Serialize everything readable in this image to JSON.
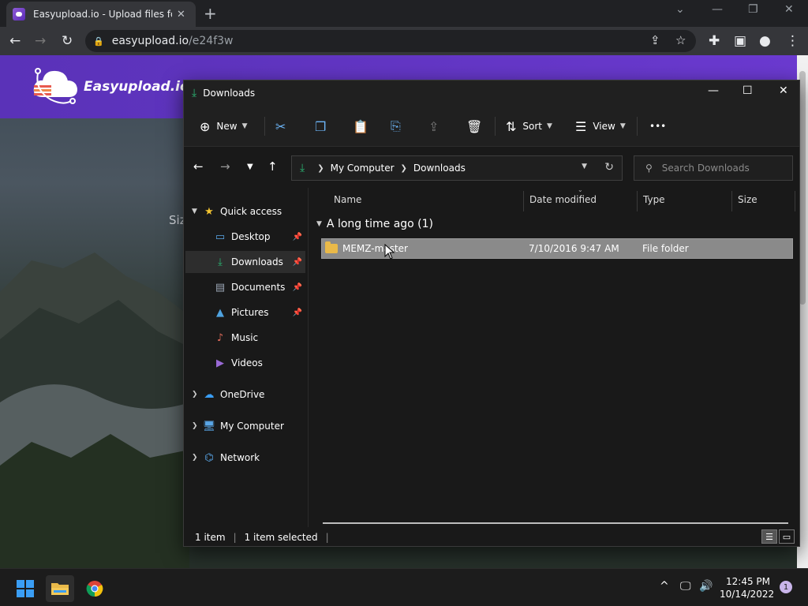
{
  "browser": {
    "tab_title": "Easyupload.io - Upload files for f",
    "tab_close": "✕",
    "new_tab": "+",
    "url_host": "easyupload.io",
    "url_path": "/e24f3w"
  },
  "website": {
    "logo_text": "Easyupload.io",
    "partial_text": "Siz"
  },
  "explorer": {
    "title": "Downloads",
    "commands": {
      "new": "New",
      "sort": "Sort",
      "view": "View",
      "more": "•••"
    },
    "address": {
      "crumbs": [
        "My Computer",
        "Downloads"
      ]
    },
    "search_placeholder": "Search Downloads",
    "nav_pane": [
      {
        "label": "Quick access",
        "icon": "star-icon"
      },
      {
        "label": "Desktop",
        "icon": "desktop-icon",
        "pinned": true
      },
      {
        "label": "Downloads",
        "icon": "download-icon",
        "pinned": true,
        "selected": true
      },
      {
        "label": "Documents",
        "icon": "document-icon",
        "pinned": true
      },
      {
        "label": "Pictures",
        "icon": "pictures-icon",
        "pinned": true
      },
      {
        "label": "Music",
        "icon": "music-icon"
      },
      {
        "label": "Videos",
        "icon": "videos-icon"
      },
      {
        "label": "OneDrive",
        "icon": "cloud-icon"
      },
      {
        "label": "My Computer",
        "icon": "computer-icon"
      },
      {
        "label": "Network",
        "icon": "network-icon"
      }
    ],
    "columns": {
      "name": "Name",
      "date": "Date modified",
      "type": "Type",
      "size": "Size"
    },
    "group_header": "A long time ago (1)",
    "rows": [
      {
        "name": "MEMZ-master",
        "date": "7/10/2016 9:47 AM",
        "type": "File folder",
        "size": ""
      }
    ],
    "status": {
      "count": "1 item",
      "selected": "1 item selected"
    }
  },
  "taskbar": {
    "time": "12:45 PM",
    "date": "10/14/2022",
    "notifications": "1"
  },
  "colors": {
    "site_header": "#5a32b8",
    "download_green": "#2bb673",
    "folder_yellow": "#e9b949",
    "selection_gray": "#8a8a8a"
  }
}
